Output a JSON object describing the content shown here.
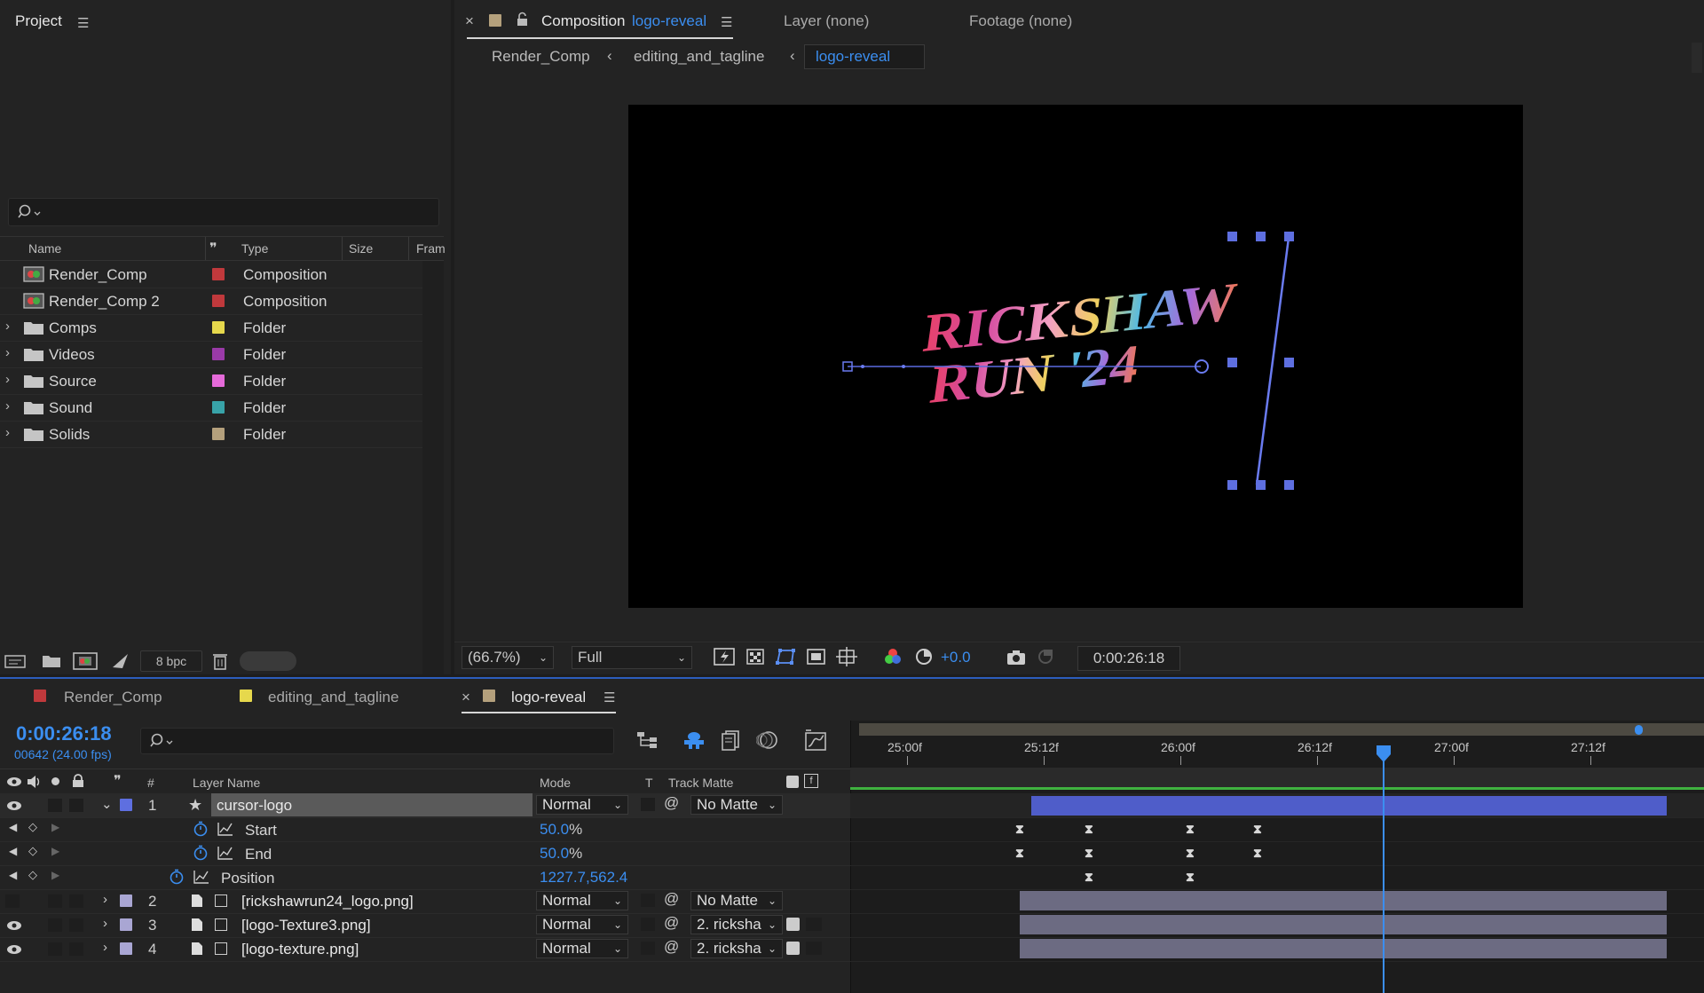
{
  "project": {
    "title": "Project",
    "columns": [
      "Name",
      "Type",
      "Size",
      "Fram"
    ],
    "items": [
      {
        "name": "Render_Comp",
        "type": "Composition",
        "color": "#c0393c",
        "kind": "comp"
      },
      {
        "name": "Render_Comp 2",
        "type": "Composition",
        "color": "#c0393c",
        "kind": "comp"
      },
      {
        "name": "Comps",
        "type": "Folder",
        "color": "#e6d84c",
        "kind": "folder"
      },
      {
        "name": "Videos",
        "type": "Folder",
        "color": "#9a3aa8",
        "kind": "folder"
      },
      {
        "name": "Source",
        "type": "Folder",
        "color": "#e56ad9",
        "kind": "folder"
      },
      {
        "name": "Sound",
        "type": "Folder",
        "color": "#38a3a8",
        "kind": "folder"
      },
      {
        "name": "Solids",
        "type": "Folder",
        "color": "#b4a07c",
        "kind": "folder"
      }
    ],
    "bpc": "8 bpc"
  },
  "viewer": {
    "comp_label": "Composition",
    "comp_name": "logo-reveal",
    "layer_tab": "Layer (none)",
    "footage_tab": "Footage (none)",
    "breadcrumbs": [
      "Render_Comp",
      "editing_and_tagline",
      "logo-reveal"
    ],
    "zoom": "(66.7%)",
    "resolution": "Full",
    "exposure": "+0.0",
    "timecode": "0:00:26:18",
    "logo_line1": "RICKSHAW",
    "logo_line2": "RUN '24"
  },
  "timeline": {
    "tabs": [
      {
        "name": "Render_Comp",
        "color": "#c0393c"
      },
      {
        "name": "editing_and_tagline",
        "color": "#e6d84c"
      },
      {
        "name": "logo-reveal",
        "color": "#b4a07c"
      }
    ],
    "current_time": "0:00:26:18",
    "frame_info": "00642 (24.00 fps)",
    "headers": {
      "num": "#",
      "layer_name": "Layer Name",
      "mode": "Mode",
      "t": "T",
      "track_matte": "Track Matte"
    },
    "ruler": [
      "25:00f",
      "25:12f",
      "26:00f",
      "26:12f",
      "27:00f",
      "27:12f"
    ],
    "layers": [
      {
        "num": "1",
        "name": "cursor-logo",
        "mode": "Normal",
        "matte": "No Matte",
        "color": "#5e6fe0"
      },
      {
        "num": "2",
        "name": "[rickshawrun24_logo.png]",
        "mode": "Normal",
        "matte": "No Matte",
        "color": "#a9a6d3"
      },
      {
        "num": "3",
        "name": "[logo-Texture3.png]",
        "mode": "Normal",
        "matte": "2. ricksha",
        "color": "#a9a6d3"
      },
      {
        "num": "4",
        "name": "[logo-texture.png]",
        "mode": "Normal",
        "matte": "2. ricksha",
        "color": "#a9a6d3"
      }
    ],
    "properties": [
      {
        "name": "Start",
        "value": "50.0",
        "unit": "%"
      },
      {
        "name": "End",
        "value": "50.0",
        "unit": "%"
      },
      {
        "name": "Position",
        "value": "1227.7,562.4",
        "unit": ""
      }
    ]
  }
}
